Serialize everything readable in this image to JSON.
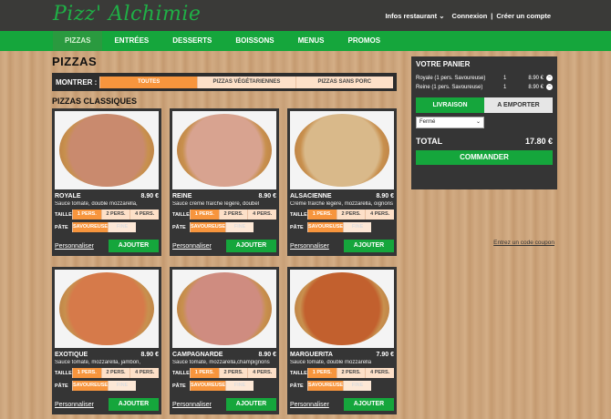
{
  "header": {
    "logo": "Pizz' Alchimie",
    "info": "Infos restaurant",
    "login": "Connexion",
    "sep": "|",
    "signup": "Créer un compte"
  },
  "nav": [
    "PIZZAS",
    "ENTRÉES",
    "DESSERTS",
    "BOISSONS",
    "MENUS",
    "PROMOS"
  ],
  "main": {
    "title": "PIZZAS",
    "filter_label": "MONTRER :",
    "filters": [
      "TOUTES",
      "PIZZAS VÉGÉTARIENNES",
      "PIZZAS SANS PORC"
    ],
    "section": "PIZZAS CLASSIQUES"
  },
  "option_labels": {
    "size": "TAILLE",
    "pate": "PÂTE",
    "sizes": [
      "1 PERS.",
      "2 PERS.",
      "4 PERS."
    ],
    "pates": [
      "SAVOUREUSE",
      "FINE"
    ],
    "customize": "Personnaliser",
    "add": "AJOUTER"
  },
  "pizzas": [
    {
      "name": "ROYALE",
      "price": "8.90 €",
      "desc": "Sauce tomate, double mozzarella,",
      "color": "#c98a6e"
    },
    {
      "name": "REINE",
      "price": "8.90 €",
      "desc": "Sauce crème fraîche légère, doubel",
      "color": "#d8a390"
    },
    {
      "name": "ALSACIENNE",
      "price": "8.90 €",
      "desc": "Crème fraîche légère, mozzarella, oignons",
      "color": "#d9b98a"
    },
    {
      "name": "EXOTIQUE",
      "price": "8.90 €",
      "desc": "Sauce tomate, mozzarella, jambon,",
      "color": "#d67a4a"
    },
    {
      "name": "CAMPAGNARDE",
      "price": "8.90 €",
      "desc": "Sauce tomate, mozzarella,champignons",
      "color": "#cf8c80"
    },
    {
      "name": "MARGUERITA",
      "price": "7.90 €",
      "desc": "Sauce tomate, double mozzarella",
      "color": "#c2602e"
    }
  ],
  "cart": {
    "title": "VOTRE PANIER",
    "items": [
      {
        "name": "Royale (1 pers. Savoureuse)",
        "qty": "1",
        "price": "8.90 €"
      },
      {
        "name": "Reine (1 pers. Savoureuse)",
        "qty": "1",
        "price": "8.90 €"
      }
    ],
    "delivery": "LIVRAISON",
    "takeaway": "A EMPORTER",
    "store": "Fermé",
    "total_label": "TOTAL",
    "total": "17.80 €",
    "order": "COMMANDER",
    "coupon": "Entrez un code coupon"
  }
}
